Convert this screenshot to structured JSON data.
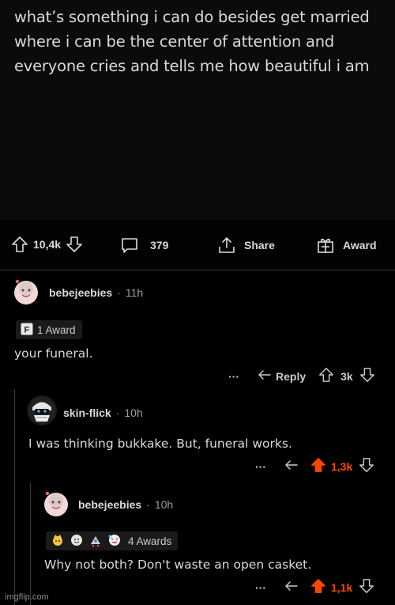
{
  "post": {
    "title": "what’s something i can do besides get married where i can be the center of attention and everyone cries and tells me how beautiful i am"
  },
  "actions": {
    "votes": "10,4k",
    "comments": "379",
    "share": "Share",
    "award": "Award"
  },
  "comments": [
    {
      "user": "bebejeebies",
      "time": "11h",
      "awards_label": "1 Award",
      "text": "your funeral.",
      "more": "···",
      "reply_label": "Reply",
      "score": "3k"
    },
    {
      "user": "skin-flick",
      "time": "10h",
      "text": "I was thinking bukkake. But, funeral works.",
      "more": "···",
      "score": "1,3k"
    },
    {
      "user": "bebejeebies",
      "time": "10h",
      "awards_label": "4 Awards",
      "text": "Why not both? Don't waste an open casket.",
      "more": "···",
      "score": "1,1k"
    }
  ],
  "sep": "·",
  "watermark": "imgflip.com",
  "colors": {
    "upvote_active": "#ff4500",
    "text": "#d7dadc",
    "bg": "#000000"
  }
}
